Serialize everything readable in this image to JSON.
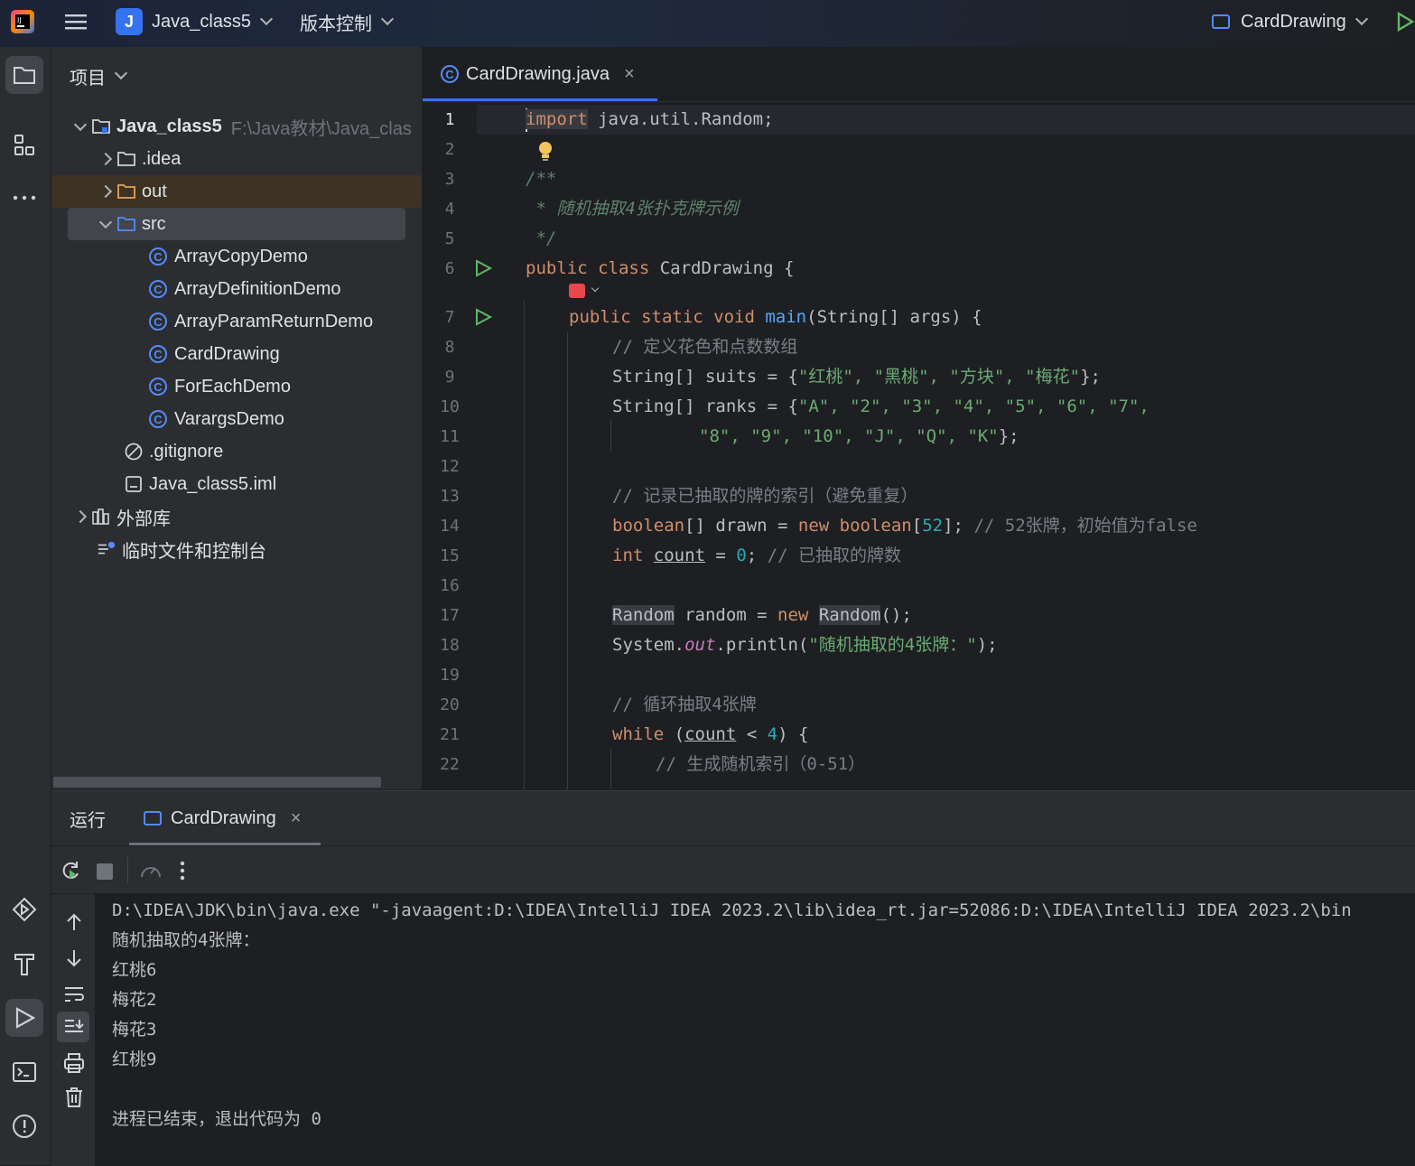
{
  "titlebar": {
    "project_badge": "J",
    "project_name": "Java_class5",
    "vcs_label": "版本控制",
    "run_config": "CardDrawing"
  },
  "project_panel": {
    "title": "项目",
    "root_name": "Java_class5",
    "root_path": "F:\\Java教材\\Java_clas",
    "items": [
      {
        "label": ".idea"
      },
      {
        "label": "out"
      },
      {
        "label": "src"
      },
      {
        "label": "ArrayCopyDemo"
      },
      {
        "label": "ArrayDefinitionDemo"
      },
      {
        "label": "ArrayParamReturnDemo"
      },
      {
        "label": "CardDrawing"
      },
      {
        "label": "ForEachDemo"
      },
      {
        "label": "VarargsDemo"
      },
      {
        "label": ".gitignore"
      },
      {
        "label": "Java_class5.iml"
      },
      {
        "label": "外部库"
      },
      {
        "label": "临时文件和控制台"
      }
    ]
  },
  "editor": {
    "tab_label": "CardDrawing.java",
    "line_numbers": [
      "1",
      "2",
      "3",
      "4",
      "5",
      "6",
      "7",
      "8",
      "9",
      "10",
      "11",
      "12",
      "13",
      "14",
      "15",
      "16",
      "17",
      "18",
      "19",
      "20",
      "21",
      "22"
    ],
    "code": {
      "l1_kw": "import",
      "l1_rest": " java.util.Random;",
      "l3": "/**",
      "l4": " * 随机抽取4张扑克牌示例",
      "l5": " */",
      "l6_kw": "public class",
      "l6_rest": " CardDrawing {",
      "l7_kw": "public static void",
      "l7_fn": "main",
      "l7_rest": "(String[] args) {",
      "l8": "// 定义花色和点数数组",
      "l9_a": "String[] suits = {",
      "l9_s": "\"红桃\", \"黑桃\", \"方块\", \"梅花\"",
      "l9_b": "};",
      "l10_a": "String[] ranks = {",
      "l10_s": "\"A\", \"2\", \"3\", \"4\", \"5\", \"6\", \"7\",",
      "l11_s": "\"8\", \"9\", \"10\", \"J\", \"Q\", \"K\"",
      "l11_b": "};",
      "l13": "// 记录已抽取的牌的索引（避免重复）",
      "l14_kw": "boolean",
      "l14_a": "[] drawn = ",
      "l14_kw2": "new boolean",
      "l14_b": "[",
      "l14_num": "52",
      "l14_c": "]; ",
      "l14_cm": "// 52张牌，初始值为false",
      "l15_kw": "int",
      "l15_var": "count",
      "l15_a": " = ",
      "l15_num": "0",
      "l15_b": "; ",
      "l15_cm": "// 已抽取的牌数",
      "l17_t": "Random",
      "l17_a": " random = ",
      "l17_kw": "new",
      "l17_t2": "Random",
      "l17_b": "();",
      "l18_a": "System.",
      "l18_fld": "out",
      "l18_b": ".println(",
      "l18_s": "\"随机抽取的4张牌：\"",
      "l18_c": ");",
      "l20": "// 循环抽取4张牌",
      "l21_kw": "while",
      "l21_a": " (",
      "l21_var": "count",
      "l21_b": " < ",
      "l21_num": "4",
      "l21_c": ") {",
      "l22": "// 生成随机索引（0-51）"
    }
  },
  "run_panel": {
    "title": "运行",
    "tab_label": "CardDrawing",
    "output": [
      "D:\\IDEA\\JDK\\bin\\java.exe \"-javaagent:D:\\IDEA\\IntelliJ IDEA 2023.2\\lib\\idea_rt.jar=52086:D:\\IDEA\\IntelliJ IDEA 2023.2\\bin",
      "随机抽取的4张牌：",
      "红桃6",
      "梅花2",
      "梅花3",
      "红桃9",
      "",
      "进程已结束，退出代码为 0"
    ]
  },
  "colors": {
    "accent": "#3574f0",
    "run_green": "#5fb865",
    "class_icon": "#548af7"
  }
}
